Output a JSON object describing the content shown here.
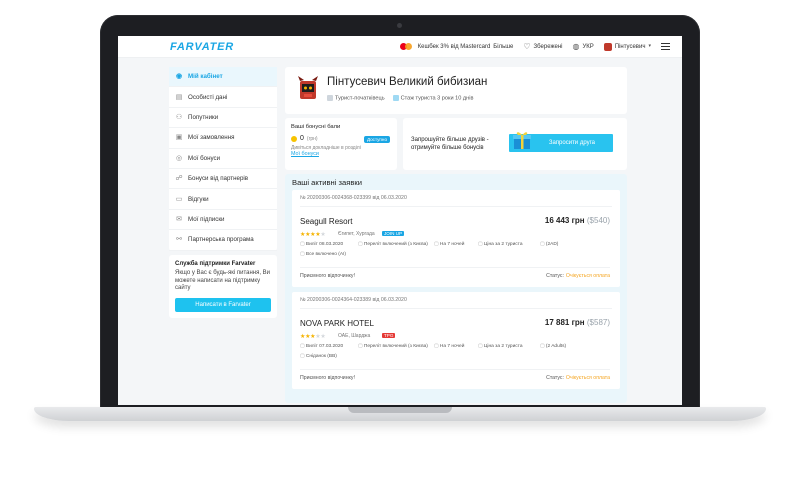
{
  "header": {
    "logo": "FARVATER",
    "cashback": "Кешбек 3% від Mastercard",
    "more": "Більше",
    "saved": "Збережені",
    "language": "УКР",
    "user": "Пінтусевич"
  },
  "sidebar": {
    "items": [
      {
        "label": "Мій кабінет",
        "icon": "home-icon"
      },
      {
        "label": "Особисті дані",
        "icon": "doc-icon"
      },
      {
        "label": "Попутники",
        "icon": "users-icon"
      },
      {
        "label": "Мої замовлення",
        "icon": "bag-icon"
      },
      {
        "label": "Мої бонуси",
        "icon": "coin-icon"
      },
      {
        "label": "Бонуси від партнерів",
        "icon": "handshake-icon"
      },
      {
        "label": "Відгуки",
        "icon": "chat-icon"
      },
      {
        "label": "Мої підписки",
        "icon": "mail-icon"
      },
      {
        "label": "Партнерська програма",
        "icon": "partner-icon"
      }
    ]
  },
  "support": {
    "title": "Служба підтримки Farvater",
    "text": "Якщо у Вас є будь-які питання, Ви можете написати на підтримку сайту",
    "button": "Написати в Farvater"
  },
  "profile": {
    "name": "Пінтусевич Великий бибизиан",
    "status": "Турист-початківець",
    "experience": "Стаж туриста 3 роки 10 днів"
  },
  "bonus": {
    "title": "Ваші бонусні бали",
    "badge": "Доступно",
    "amount": "0",
    "currency": "(грн)",
    "hint": "Дивіться докладніше в розділі",
    "link": "Мої бонуси"
  },
  "invite": {
    "text": "Запрошуйте більше друзів - отримуйте більше бонусів",
    "button": "Запросити друга"
  },
  "bookings": {
    "heading": "Ваші активні заявки",
    "items": [
      {
        "number": "№ 20200306-0024368-023399 від 06.03.2020",
        "hotel": "Seagull Resort",
        "price": "16 443 грн",
        "price_usd": "($540)",
        "stars": 4,
        "location": "Єгипет, Хургада",
        "operator": "JOIN UP",
        "operator_color": "#1aa6e4",
        "departure": "Виліт 08.03.2020",
        "flight": "Переліт включений (з Києва)",
        "nights": "На 7 ночей",
        "tourists": "Ціна за 2 туриста",
        "guests": "(2AD)",
        "meal": "Все включено (AI)",
        "footer": "Приємного відпочинку!",
        "status_label": "Статус:",
        "status": "Очікується оплата"
      },
      {
        "number": "№ 20200306-0024364-023389 від 06.03.2020",
        "hotel": "NOVA PARK HOTEL",
        "price": "17 881 грн",
        "price_usd": "($587)",
        "stars": 3,
        "location": "ОАЕ, Шарджа",
        "operator": "TPG",
        "operator_color": "#e53935",
        "departure": "Виліт 07.03.2020",
        "flight": "Переліт включений (з Києва)",
        "nights": "На 7 ночей",
        "tourists": "Ціна за 2 туриста",
        "guests": "(2 Adults)",
        "meal": "Сніданок (BB)",
        "footer": "Приємного відпочинку!",
        "status_label": "Статус:",
        "status": "Очікується оплата"
      }
    ]
  },
  "colors": {
    "accent": "#1aa6e4",
    "button": "#1ec2ef",
    "status": "#f5a623",
    "stars": "#f5b301"
  }
}
